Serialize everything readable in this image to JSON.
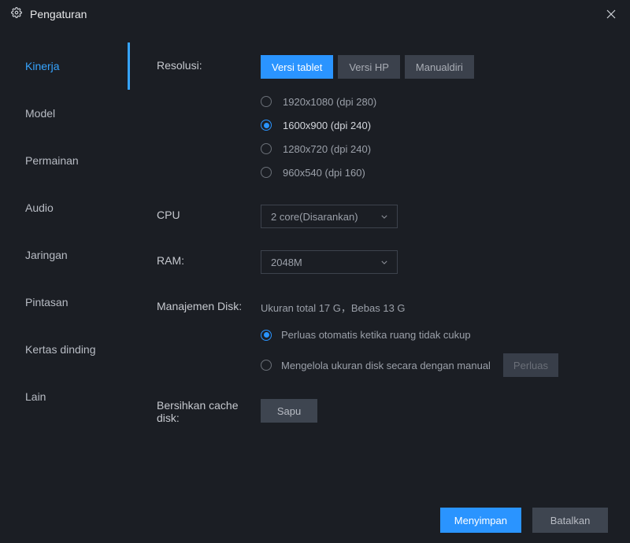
{
  "title": "Pengaturan",
  "sidebar": {
    "items": [
      {
        "label": "Kinerja",
        "active": true
      },
      {
        "label": "Model",
        "active": false
      },
      {
        "label": "Permainan",
        "active": false
      },
      {
        "label": "Audio",
        "active": false
      },
      {
        "label": "Jaringan",
        "active": false
      },
      {
        "label": "Pintasan",
        "active": false
      },
      {
        "label": "Kertas dinding",
        "active": false
      },
      {
        "label": "Lain",
        "active": false
      }
    ]
  },
  "resolution": {
    "label": "Resolusi:",
    "tabs": {
      "tablet": "Versi tablet",
      "phone": "Versi HP",
      "manual": "Manualdiri"
    },
    "options": [
      {
        "text": "1920x1080  (dpi 280)",
        "selected": false
      },
      {
        "text": "1600x900  (dpi 240)",
        "selected": true
      },
      {
        "text": "1280x720  (dpi 240)",
        "selected": false
      },
      {
        "text": "960x540  (dpi 160)",
        "selected": false
      }
    ]
  },
  "cpu": {
    "label": "CPU",
    "value": "2 core(Disarankan)"
  },
  "ram": {
    "label": "RAM:",
    "value": "2048M"
  },
  "disk": {
    "label": "Manajemen Disk:",
    "info": "Ukuran total 17 G，Bebas 13 G",
    "opt_auto": "Perluas otomatis ketika ruang tidak cukup",
    "opt_manual": "Mengelola ukuran disk secara dengan manual",
    "expand_btn": "Perluas"
  },
  "cache": {
    "label": "Bersihkan cache disk:",
    "btn": "Sapu"
  },
  "footer": {
    "save": "Menyimpan",
    "cancel": "Batalkan"
  }
}
